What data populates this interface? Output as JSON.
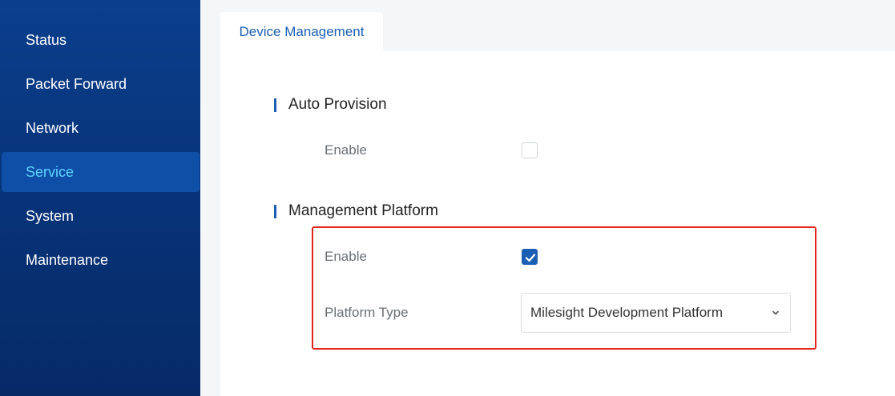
{
  "sidebar": {
    "items": [
      {
        "label": "Status"
      },
      {
        "label": "Packet Forward"
      },
      {
        "label": "Network"
      },
      {
        "label": "Service",
        "active": true
      },
      {
        "label": "System"
      },
      {
        "label": "Maintenance"
      }
    ]
  },
  "tabs": [
    {
      "label": "Device Management",
      "active": true
    }
  ],
  "auto_provision": {
    "title": "Auto Provision",
    "enable_label": "Enable",
    "enabled": false
  },
  "management_platform": {
    "title": "Management Platform",
    "enable_label": "Enable",
    "enabled": true,
    "platform_type_label": "Platform Type",
    "platform_type_value": "Milesight Development Platform"
  },
  "colors": {
    "sidebar_bg": "#08347a",
    "accent": "#1a5fb4",
    "active_nav_text": "#5fd3ff",
    "highlight_border": "#e0261c"
  },
  "icons": {
    "checkmark": "check-icon",
    "dropdown": "chevron-down-icon"
  }
}
